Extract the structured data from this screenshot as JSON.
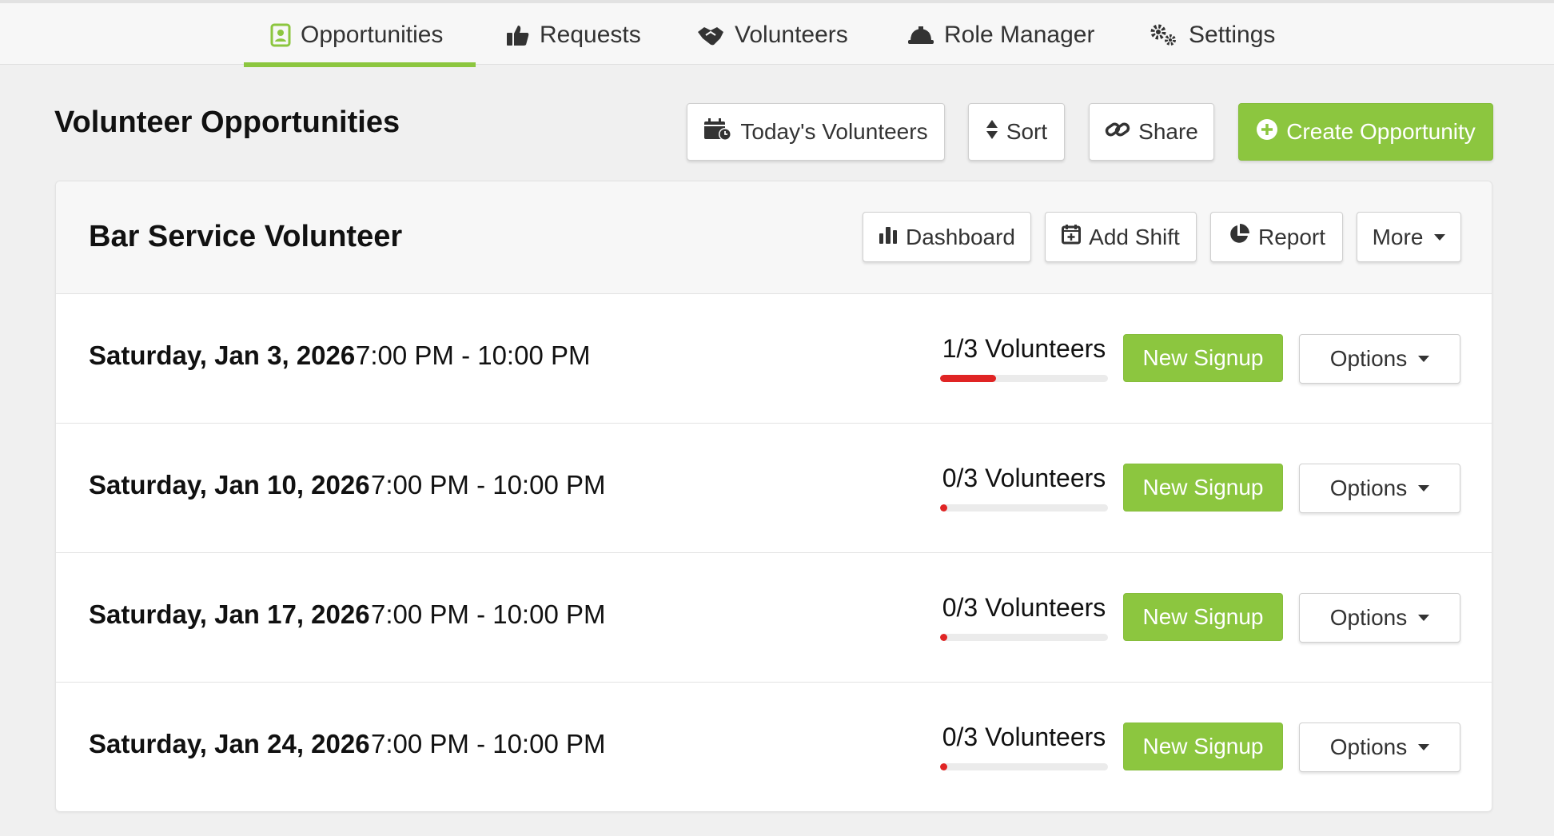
{
  "nav": {
    "tabs": [
      {
        "label": "Opportunities",
        "icon": "contact-card-icon",
        "active": true
      },
      {
        "label": "Requests",
        "icon": "thumbs-up-icon",
        "active": false
      },
      {
        "label": "Volunteers",
        "icon": "handshake-icon",
        "active": false
      },
      {
        "label": "Role Manager",
        "icon": "hard-hat-icon",
        "active": false
      },
      {
        "label": "Settings",
        "icon": "gears-icon",
        "active": false
      }
    ]
  },
  "header": {
    "title": "Volunteer Opportunities",
    "todays_volunteers_label": "Today's Volunteers",
    "sort_label": "Sort",
    "share_label": "Share",
    "create_label": "Create Opportunity"
  },
  "opportunity": {
    "title": "Bar Service Volunteer",
    "dashboard_label": "Dashboard",
    "add_shift_label": "Add Shift",
    "report_label": "Report",
    "more_label": "More"
  },
  "shifts": [
    {
      "date": "Saturday, Jan 3, 2026",
      "time": "7:00 PM - 10:00 PM",
      "volunteers": "1/3 Volunteers",
      "filled": 1,
      "capacity": 3,
      "signup_label": "New Signup",
      "options_label": "Options"
    },
    {
      "date": "Saturday, Jan 10, 2026",
      "time": "7:00 PM - 10:00 PM",
      "volunteers": "0/3 Volunteers",
      "filled": 0,
      "capacity": 3,
      "signup_label": "New Signup",
      "options_label": "Options"
    },
    {
      "date": "Saturday, Jan 17, 2026",
      "time": "7:00 PM - 10:00 PM",
      "volunteers": "0/3 Volunteers",
      "filled": 0,
      "capacity": 3,
      "signup_label": "New Signup",
      "options_label": "Options"
    },
    {
      "date": "Saturday, Jan 24, 2026",
      "time": "7:00 PM - 10:00 PM",
      "volunteers": "0/3 Volunteers",
      "filled": 0,
      "capacity": 3,
      "signup_label": "New Signup",
      "options_label": "Options"
    }
  ],
  "colors": {
    "accent": "#8cc63f",
    "progress": "#e02424"
  }
}
